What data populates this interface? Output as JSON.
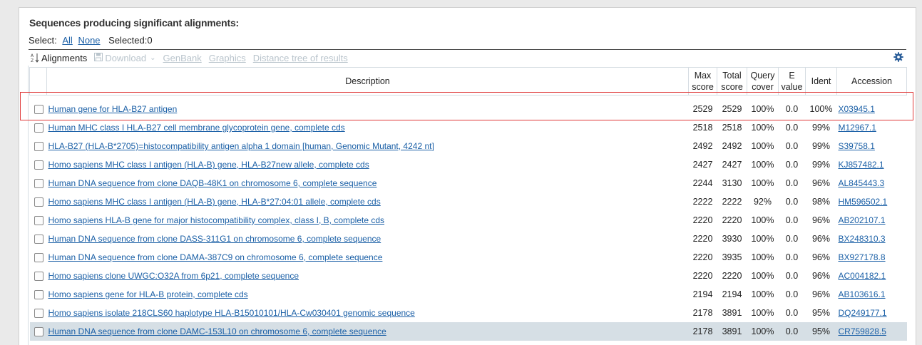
{
  "section_title": "Sequences producing significant alignments:",
  "select_bar": {
    "label": "Select:",
    "all": "All",
    "none": "None",
    "selected": "Selected:0"
  },
  "toolbar": {
    "alignments": "Alignments",
    "download": "Download",
    "genbank": "GenBank",
    "graphics": "Graphics",
    "distance_tree": "Distance tree of results",
    "sort_icon": "sort-az-icon",
    "download_icon": "floppy-disk-icon",
    "caret_icon": "chevron-down-icon",
    "settings_icon": "gear-icon"
  },
  "columns": {
    "description": "Description",
    "max_score_1": "Max",
    "max_score_2": "score",
    "total_score_1": "Total",
    "total_score_2": "score",
    "query_cover_1": "Query",
    "query_cover_2": "cover",
    "e_value_1": "E",
    "e_value_2": "value",
    "ident": "Ident",
    "accession": "Accession"
  },
  "rows": [
    {
      "description": "Human gene for HLA-B27 antigen",
      "max": "2529",
      "total": "2529",
      "cover": "100%",
      "evalue": "0.0",
      "ident": "100%",
      "accession": "X03945.1"
    },
    {
      "description": "Human MHC class I HLA-B27 cell membrane glycoprotein gene, complete cds",
      "max": "2518",
      "total": "2518",
      "cover": "100%",
      "evalue": "0.0",
      "ident": "99%",
      "accession": "M12967.1"
    },
    {
      "description": "HLA-B27 (HLA-B*2705)=histocompatibility antigen alpha 1 domain [human, Genomic Mutant, 4242 nt]",
      "max": "2492",
      "total": "2492",
      "cover": "100%",
      "evalue": "0.0",
      "ident": "99%",
      "accession": "S39758.1"
    },
    {
      "description": "Homo sapiens MHC class I antigen (HLA-B) gene, HLA-B27new allele, complete cds",
      "max": "2427",
      "total": "2427",
      "cover": "100%",
      "evalue": "0.0",
      "ident": "99%",
      "accession": "KJ857482.1"
    },
    {
      "description": "Human DNA sequence from clone DAQB-48K1 on chromosome 6, complete sequence",
      "max": "2244",
      "total": "3130",
      "cover": "100%",
      "evalue": "0.0",
      "ident": "96%",
      "accession": "AL845443.3"
    },
    {
      "description": "Homo sapiens MHC class I antigen (HLA-B) gene, HLA-B*27:04:01 allele, complete cds",
      "max": "2222",
      "total": "2222",
      "cover": "92%",
      "evalue": "0.0",
      "ident": "98%",
      "accession": "HM596502.1"
    },
    {
      "description": "Homo sapiens HLA-B gene for major histocompatibility complex, class I, B, complete cds",
      "max": "2220",
      "total": "2220",
      "cover": "100%",
      "evalue": "0.0",
      "ident": "96%",
      "accession": "AB202107.1"
    },
    {
      "description": "Human DNA sequence from clone DASS-311G1 on chromosome 6, complete sequence",
      "max": "2220",
      "total": "3930",
      "cover": "100%",
      "evalue": "0.0",
      "ident": "96%",
      "accession": "BX248310.3"
    },
    {
      "description": "Human DNA sequence from clone DAMA-387C9 on chromosome 6, complete sequence",
      "max": "2220",
      "total": "3935",
      "cover": "100%",
      "evalue": "0.0",
      "ident": "96%",
      "accession": "BX927178.8"
    },
    {
      "description": "Homo sapiens clone UWGC:O32A from 6p21, complete sequence",
      "max": "2220",
      "total": "2220",
      "cover": "100%",
      "evalue": "0.0",
      "ident": "96%",
      "accession": "AC004182.1"
    },
    {
      "description": "Homo sapiens gene for HLA-B protein, complete cds",
      "max": "2194",
      "total": "2194",
      "cover": "100%",
      "evalue": "0.0",
      "ident": "96%",
      "accession": "AB103616.1"
    },
    {
      "description": "Homo sapiens isolate 218CLS60 haplotype HLA-B15010101/HLA-Cw030401 genomic sequence",
      "max": "2178",
      "total": "3891",
      "cover": "100%",
      "evalue": "0.0",
      "ident": "95%",
      "accession": "DQ249177.1"
    },
    {
      "description": "Human DNA sequence from clone DAMC-153L10 on chromosome 6, complete sequence",
      "max": "2178",
      "total": "3891",
      "cover": "100%",
      "evalue": "0.0",
      "ident": "95%",
      "accession": "CR759828.5"
    }
  ],
  "colors": {
    "link": "#1a5fa6",
    "highlight_row": "#d6dfe5",
    "annotation_box": "#e03a3a",
    "disabled": "#b9c4cc"
  }
}
